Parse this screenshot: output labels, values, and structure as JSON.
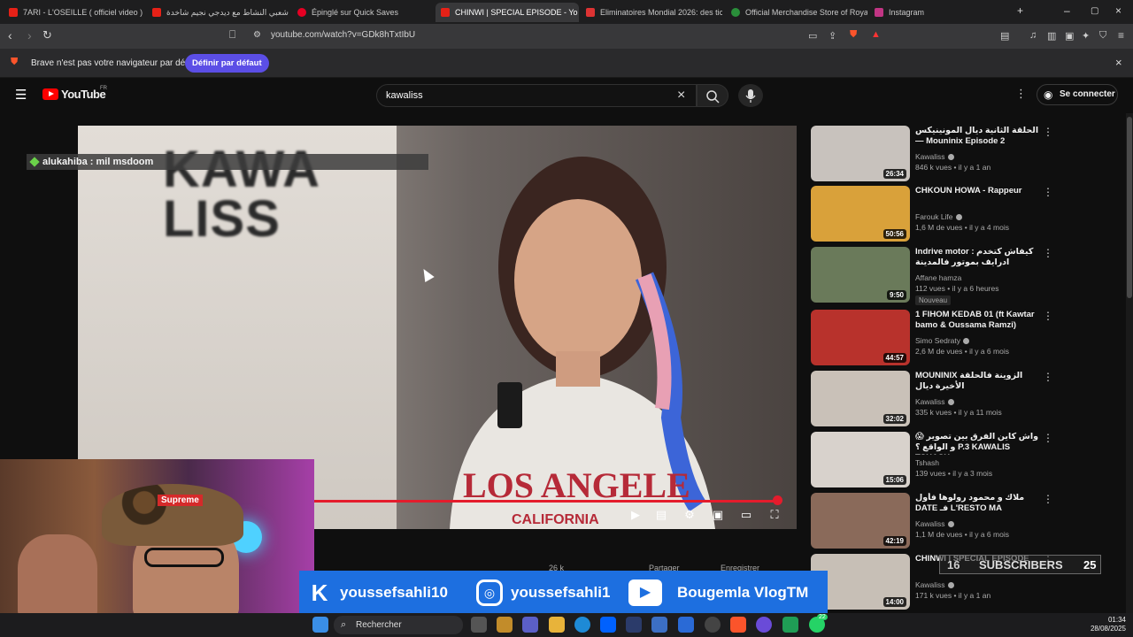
{
  "browser": {
    "tabs": [
      {
        "label": "7ARI - L'OSEILLE ( officiel video ) - Yo",
        "color": "#e62117"
      },
      {
        "label": "شعبي النشاط مع ديدجي نجيم شاخدة",
        "color": "#e62117"
      },
      {
        "label": "Épinglé sur Quick Saves",
        "color": "#e60023"
      },
      {
        "label": "CHINWI | SPECIAL EPISODE - Yo",
        "color": "#e62117"
      },
      {
        "label": "Eliminatoires Mondial 2026: des ticke",
        "color": "#d33"
      },
      {
        "label": "Official Merchandise Store of Royal",
        "color": "#2a8f3a"
      },
      {
        "label": "Instagram",
        "color": "#c13584"
      }
    ],
    "new_tab": "+",
    "url": "youtube.com/watch?v=GDk8hTxtIbU",
    "infobar_message": "Brave n'est pas votre navigateur par défaut",
    "infobar_button": "Définir par défaut",
    "infobar_close": "×",
    "shield_badge": "1"
  },
  "youtube": {
    "logo": "YouTube",
    "region": "FR",
    "search_value": "kawaliss",
    "signin_label": "Se connecter"
  },
  "player": {
    "bg_text_1": "KAWA",
    "bg_text_2": "LISS",
    "shirt_text": "LOS ANGELE",
    "shirt_sub": "CALIFORNIA",
    "comment": "alukahiba : mil msdoom",
    "likes": "26 k",
    "share_label": "Partager",
    "save_label": "Enregistrer"
  },
  "recommendations": [
    {
      "title": "الحلقة الثانية ديال المونينيكس— Mouninix Episode 2",
      "channel": "Kawaliss",
      "verified": true,
      "meta": "846 k vues • il y a 1 an",
      "duration": "26:34",
      "thumb_color": "#c8c2bd"
    },
    {
      "title": "CHKOUN HOWA - Rappeur",
      "channel": "Farouk Life",
      "verified": true,
      "meta": "1,6 M de vues • il y a 4 mois",
      "duration": "50:56",
      "thumb_color": "#d9a13a"
    },
    {
      "title": "Indrive motor : كيفاش كتخدم ادرايف بموتور فالمدينة",
      "channel": "Affane hamza",
      "verified": false,
      "meta": "112 vues • il y a 6 heures",
      "badge": "Nouveau",
      "duration": "9:50",
      "thumb_color": "#6a7a5a"
    },
    {
      "title": "1 FIHOM KEDAB 01 (ft Kawtar bamo & Oussama Ramzi)",
      "channel": "Simo Sedraty",
      "verified": true,
      "meta": "2,6 M de vues • il y a 6 mois",
      "duration": "44:57",
      "thumb_color": "#b8322c"
    },
    {
      "title": "MOUNINIX الزوينة فالحلقة الأخيرة ديال",
      "channel": "Kawaliss",
      "verified": true,
      "meta": "335 k vues • il y a 11 mois",
      "duration": "32:02",
      "thumb_color": "#c9c1b8"
    },
    {
      "title": "😱 واش كاين الفرق بين تصوير و الواقع ؟ P.3 KAWALIS TSHASH ...",
      "channel": "Tshash",
      "verified": false,
      "meta": "139 vues • il y a 3 mois",
      "duration": "15:06",
      "thumb_color": "#d8d2cc"
    },
    {
      "title": "ملاك و محمود رولوها فأول DATE فـ L'RESTO MA",
      "channel": "Kawaliss",
      "verified": true,
      "meta": "1,1 M de vues • il y a 6 mois",
      "duration": "42:19",
      "thumb_color": "#8a6a5a"
    },
    {
      "title": "CHINWI | SPECIAL EPISODE",
      "channel": "Kawaliss",
      "verified": true,
      "meta": "171 k vues • il y a 1 an",
      "duration": "14:00",
      "thumb_color": "#c7bfb6"
    }
  ],
  "overlay": {
    "subs_left": "16",
    "subs_label": "SUBSCRIBERS",
    "subs_right": "25",
    "social_1": "youssefsahli10",
    "social_2": "youssefsahli1",
    "social_3": "Bougemla VlogTM",
    "cap_logo": "Supreme"
  },
  "taskbar": {
    "search_placeholder": "Rechercher",
    "time": "01:34",
    "date": "28/08/2025",
    "wa_badge": "22"
  }
}
